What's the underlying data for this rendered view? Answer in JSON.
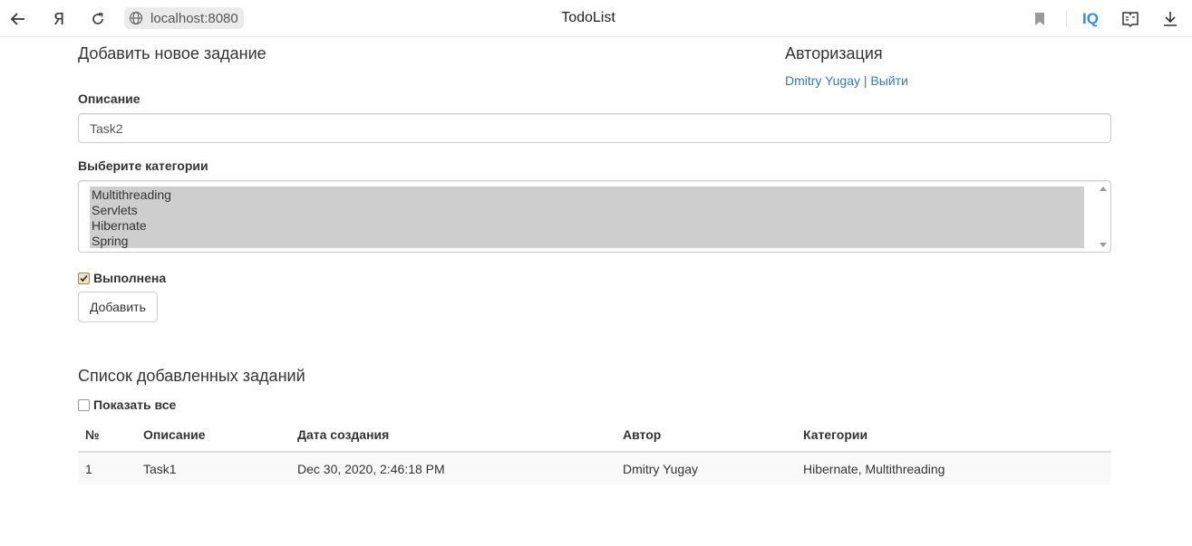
{
  "browser": {
    "url": "localhost:8080",
    "tab_title": "TodoList",
    "search_logo": "Я",
    "ext_label": "IQ"
  },
  "form": {
    "heading": "Добавить новое задание",
    "description_label": "Описание",
    "description_value": "Task2",
    "categories_label": "Выберите категории",
    "categories": [
      "Multithreading",
      "Servlets",
      "Hibernate",
      "Spring"
    ],
    "done_label": "Выполнена",
    "done_checked": true,
    "submit_label": "Добавить"
  },
  "auth": {
    "heading": "Авторизация",
    "user_name": "Dmitry Yugay",
    "separator": "|",
    "logout_label": "Выйти"
  },
  "list": {
    "heading": "Список добавленных заданий",
    "show_all_label": "Показать все",
    "show_all_checked": false,
    "columns": [
      "№",
      "Описание",
      "Дата создания",
      "Автор",
      "Категории"
    ],
    "rows": [
      [
        "1",
        "Task1",
        "Dec 30, 2020, 2:46:18 PM",
        "Dmitry Yugay",
        "Hibernate, Multithreading"
      ]
    ]
  },
  "colors": {
    "link": "#337ab7",
    "selected_option_bg": "#cecece",
    "accent": "#2e8ede"
  }
}
